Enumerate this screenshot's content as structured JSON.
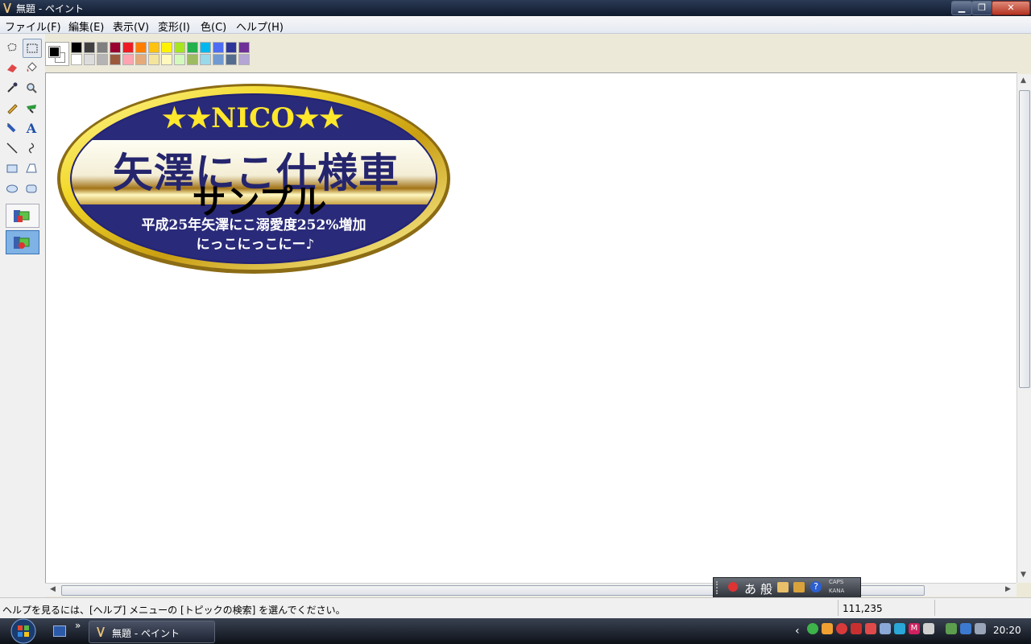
{
  "window": {
    "title": "無題 - ペイント",
    "controls": {
      "minimize": "▁",
      "maximize": "❐",
      "close": "✕"
    }
  },
  "menu": [
    {
      "label": "ファイル(F)"
    },
    {
      "label": "編集(E)"
    },
    {
      "label": "表示(V)"
    },
    {
      "label": "変形(I)"
    },
    {
      "label": "色(C)"
    },
    {
      "label": "ヘルプ(H)"
    }
  ],
  "tools": [
    {
      "name": "free-select-icon"
    },
    {
      "name": "rect-select-icon",
      "selected": true
    },
    {
      "name": "eraser-icon"
    },
    {
      "name": "fill-bucket-icon"
    },
    {
      "name": "color-picker-icon"
    },
    {
      "name": "magnifier-icon"
    },
    {
      "name": "pencil-icon"
    },
    {
      "name": "brush-icon"
    },
    {
      "name": "airbrush-icon"
    },
    {
      "name": "text-icon"
    },
    {
      "name": "line-icon"
    },
    {
      "name": "curve-icon"
    },
    {
      "name": "rectangle-icon"
    },
    {
      "name": "polygon-icon"
    },
    {
      "name": "ellipse-icon"
    },
    {
      "name": "rounded-rect-icon"
    }
  ],
  "palette": {
    "foreground": "#000000",
    "background": "#ffffff",
    "row1": [
      "#000000",
      "#404040",
      "#808080",
      "#990030",
      "#ed1c24",
      "#ff7e00",
      "#ffc20e",
      "#fff200",
      "#a8e61d",
      "#22b14c",
      "#00b7ef",
      "#4d6df3",
      "#2f3699",
      "#6f3198"
    ],
    "row2": [
      "#ffffff",
      "#dcdcdc",
      "#b4b4b4",
      "#9c5a3c",
      "#ffa3b1",
      "#e5aa7a",
      "#f5e49c",
      "#fff9bd",
      "#d3f9bc",
      "#9dbb61",
      "#99d9ea",
      "#709ad1",
      "#546d8e",
      "#b5a5d5"
    ]
  },
  "badge": {
    "top_text": "★★NICO★★",
    "main_text": "矢澤にこ仕様車",
    "overlay_text": "サンプル",
    "line1": "平成25年矢澤にこ溺愛度252%増加",
    "line2": "にっこにっこにー♪",
    "colors": {
      "navy": "#2a2a7a",
      "gold": "#f4e23b",
      "star": "#ffe82b"
    }
  },
  "ime": {
    "mode": "あ",
    "conv": "般",
    "caps": "CAPS",
    "kana": "KANA"
  },
  "status": {
    "help": "ヘルプを見るには、[ヘルプ] メニューの [トピックの検索] を選んでください。",
    "coords": "111,235"
  },
  "taskbar": {
    "quicklaunch_more": "»",
    "window_button": "無題 - ペイント",
    "tray_chevron": "‹",
    "clock": "20:20"
  }
}
